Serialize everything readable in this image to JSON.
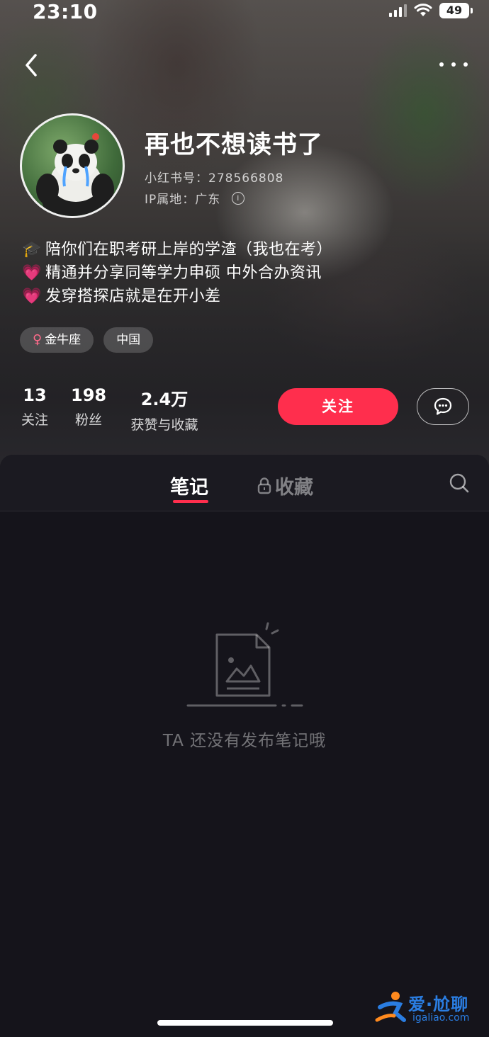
{
  "status_bar": {
    "time": "23:10",
    "battery": "49",
    "icons": [
      "signal-icon",
      "wifi-icon",
      "battery-icon"
    ]
  },
  "nav": {
    "back_icon": "chevron-left-icon",
    "more_icon": "more-icon"
  },
  "profile": {
    "nickname": "再也不想读书了",
    "red_id": "小红书号：278566808",
    "ip_location": "IP属地：广东",
    "bio": [
      {
        "emoji": "🎓",
        "text": "陪你们在职考研上岸的学渣（我也在考）"
      },
      {
        "emoji": "💗",
        "text": "精通并分享同等学力申硕 中外合办资讯"
      },
      {
        "emoji": "💗",
        "text": "发穿搭探店就是在开小差"
      }
    ],
    "tags": [
      {
        "icon": "female-icon",
        "label": "金牛座"
      },
      {
        "label": "中国"
      }
    ]
  },
  "stats": [
    {
      "value": "13",
      "label": "关注"
    },
    {
      "value": "198",
      "label": "粉丝"
    },
    {
      "value": "2.4万",
      "label": "获赞与收藏"
    }
  ],
  "actions": {
    "follow_label": "关注",
    "message_icon": "chat-bubble-icon"
  },
  "tabs": {
    "notes": "笔记",
    "collections": "收藏",
    "active": "notes",
    "search_icon": "search-icon"
  },
  "empty_state": {
    "text": "TA 还没有发布笔记哦"
  },
  "watermark": {
    "title": "爱·尬聊",
    "url": "igaliao.com"
  },
  "colors": {
    "accent": "#ff2e4d",
    "background": "#15141b",
    "watermark": "#2a7de1"
  }
}
